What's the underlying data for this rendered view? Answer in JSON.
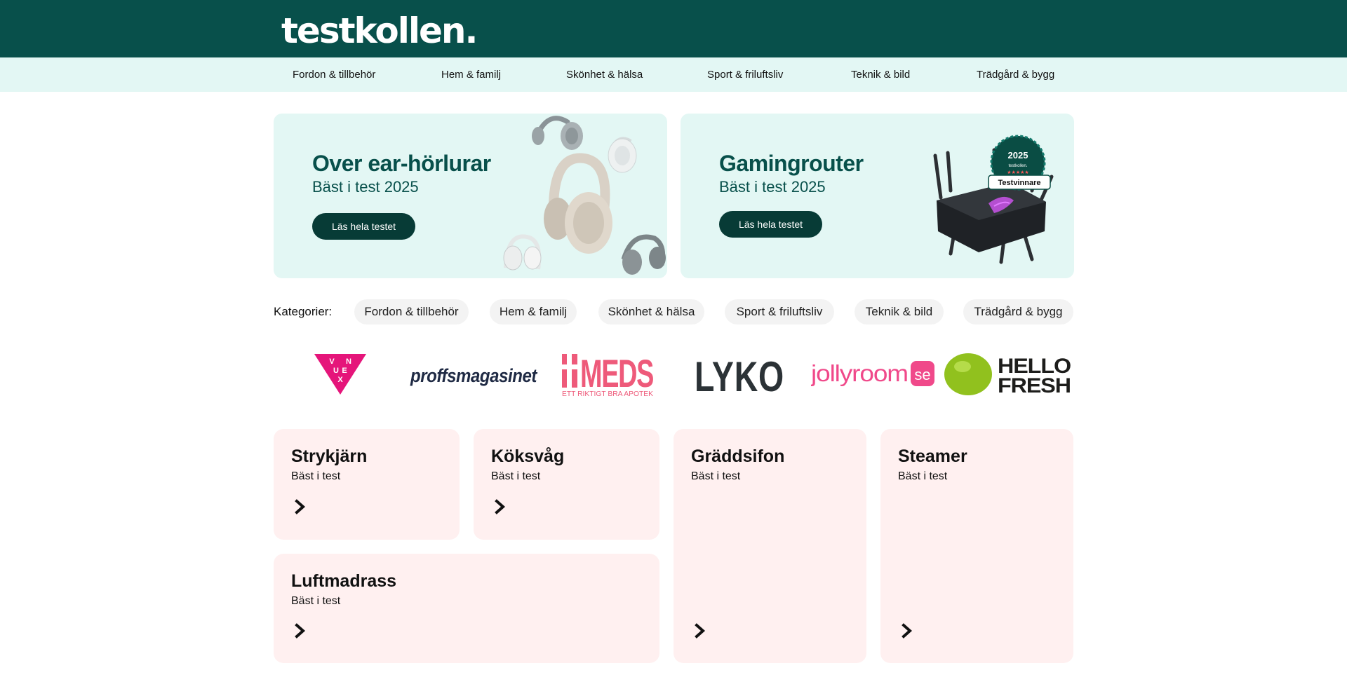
{
  "header": {
    "logo": "testkollen."
  },
  "nav": {
    "items": [
      {
        "label": "Fordon & tillbehör"
      },
      {
        "label": "Hem & familj"
      },
      {
        "label": "Skönhet & hälsa"
      },
      {
        "label": "Sport & friluftsliv"
      },
      {
        "label": "Teknik & bild"
      },
      {
        "label": "Trädgård & bygg"
      }
    ]
  },
  "heroes": [
    {
      "title": "Over ear-hörlurar",
      "subtitle": "Bäst i test 2025",
      "button": "Läs hela testet",
      "icon": "headphones-image"
    },
    {
      "title": "Gamingrouter",
      "subtitle": "Bäst i test 2025",
      "button": "Läs hela testet",
      "icon": "router-image",
      "badge": {
        "year": "2025",
        "brand": "testkollen.",
        "label": "Testvinnare"
      }
    }
  ],
  "categories": {
    "label": "Kategorier:",
    "items": [
      "Fordon & tillbehör",
      "Hem & familj",
      "Skönhet & hälsa",
      "Sport & friluftsliv",
      "Teknik & bild",
      "Trädgård & bygg"
    ]
  },
  "brands": [
    {
      "name": "Venue",
      "letters": [
        "V",
        "N",
        "U",
        "E",
        "X"
      ],
      "color": "#e5157a"
    },
    {
      "name": "proffsmagasinet",
      "color": "#1f2a44"
    },
    {
      "name": "MEDS",
      "tagline": "ETT RIKTIGT BRA APOTEK",
      "color": "#ee5a7a"
    },
    {
      "name": "LYKO",
      "color": "#2b3236"
    },
    {
      "name": "jollyroom",
      "suffix": "se",
      "color": "#f0498a"
    },
    {
      "name": "HELLO FRESH",
      "lines": [
        "HELLO",
        "FRESH"
      ],
      "color": "#1d1d1b",
      "accent": "#91c11e"
    }
  ],
  "cards": [
    {
      "title": "Strykjärn",
      "subtitle": "Bäst i test"
    },
    {
      "title": "Köksvåg",
      "subtitle": "Bäst i test"
    },
    {
      "title": "Gräddsifon",
      "subtitle": "Bäst i test"
    },
    {
      "title": "Steamer",
      "subtitle": "Bäst i test"
    },
    {
      "title": "Luftmadrass",
      "subtitle": "Bäst i test"
    }
  ],
  "colors": {
    "header_bg": "#08504b",
    "nav_bg": "#e3f7f4",
    "hero_bg": "#e3f7f4",
    "hero_text": "#08504b",
    "button_bg": "#073b36",
    "card_bg": "#fff0f0",
    "pill_bg": "#f3f3f3"
  }
}
